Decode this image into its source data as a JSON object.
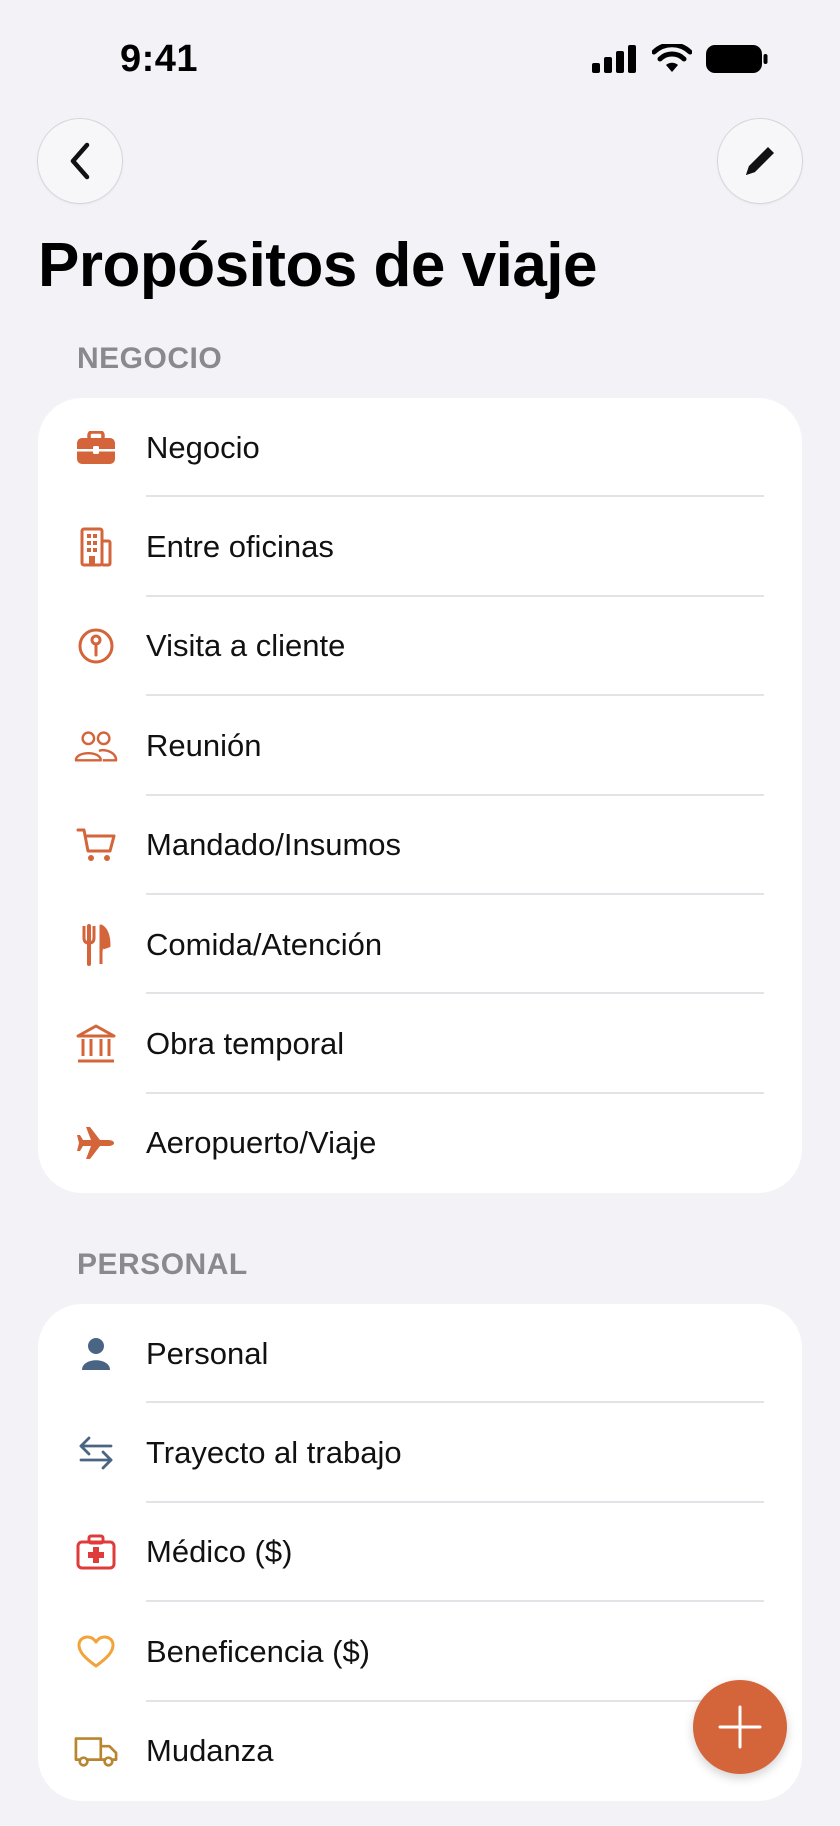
{
  "status": {
    "time": "9:41"
  },
  "title": "Propósitos de viaje",
  "colors": {
    "accent": "#d4643a",
    "personal_icon": "#4a6583",
    "medical": "#e03b3b",
    "charity": "#f2a33a",
    "moving": "#b8862f"
  },
  "sections": [
    {
      "header": "NEGOCIO",
      "items": [
        {
          "label": "Negocio",
          "icon": "briefcase-icon"
        },
        {
          "label": "Entre oficinas",
          "icon": "building-icon"
        },
        {
          "label": "Visita a cliente",
          "icon": "pin-icon"
        },
        {
          "label": "Reunión",
          "icon": "people-icon"
        },
        {
          "label": "Mandado/Insumos",
          "icon": "cart-icon"
        },
        {
          "label": "Comida/Atención",
          "icon": "fork-knife-icon"
        },
        {
          "label": "Obra temporal",
          "icon": "bank-icon"
        },
        {
          "label": "Aeropuerto/Viaje",
          "icon": "airplane-icon"
        }
      ]
    },
    {
      "header": "PERSONAL",
      "items": [
        {
          "label": "Personal",
          "icon": "person-icon"
        },
        {
          "label": "Trayecto al trabajo",
          "icon": "arrows-icon"
        },
        {
          "label": "Médico ($)",
          "icon": "medical-kit-icon"
        },
        {
          "label": "Beneficencia ($)",
          "icon": "heart-icon"
        },
        {
          "label": "Mudanza",
          "icon": "truck-icon"
        }
      ]
    }
  ]
}
